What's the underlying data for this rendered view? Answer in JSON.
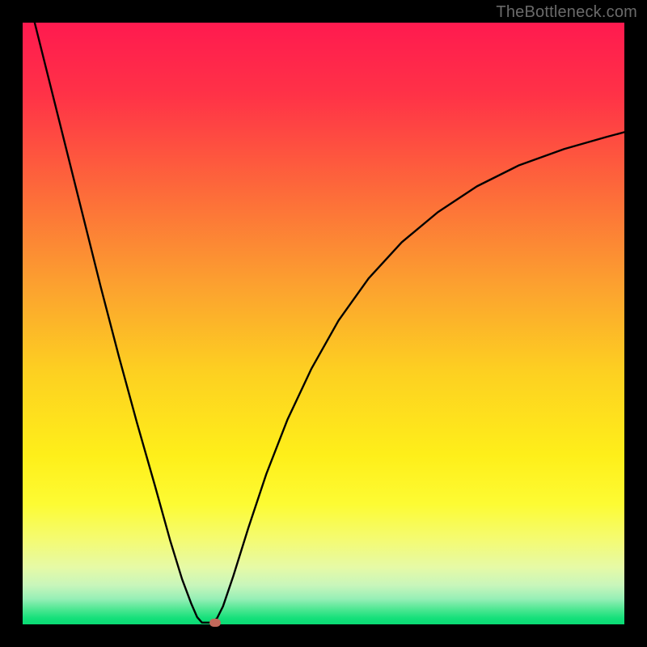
{
  "watermark": "TheBottleneck.com",
  "chart_data": {
    "type": "line",
    "title": "",
    "xlabel": "",
    "ylabel": "",
    "xlim": [
      0,
      100
    ],
    "ylim": [
      0,
      100
    ],
    "background_gradient": {
      "stops": [
        {
          "offset": 0.0,
          "color": "#ff1a4f"
        },
        {
          "offset": 0.12,
          "color": "#ff3247"
        },
        {
          "offset": 0.28,
          "color": "#fd6a3a"
        },
        {
          "offset": 0.44,
          "color": "#fca22f"
        },
        {
          "offset": 0.58,
          "color": "#fdd021"
        },
        {
          "offset": 0.72,
          "color": "#feef1a"
        },
        {
          "offset": 0.8,
          "color": "#fdfb33"
        },
        {
          "offset": 0.86,
          "color": "#f4fb73"
        },
        {
          "offset": 0.905,
          "color": "#e6faa6"
        },
        {
          "offset": 0.935,
          "color": "#c8f6bb"
        },
        {
          "offset": 0.958,
          "color": "#95efb6"
        },
        {
          "offset": 0.975,
          "color": "#4ee792"
        },
        {
          "offset": 0.99,
          "color": "#14e07a"
        },
        {
          "offset": 1.0,
          "color": "#0adb74"
        }
      ]
    },
    "series": [
      {
        "name": "bottleneck-curve",
        "color": "#000000",
        "points": [
          {
            "x": 2.0,
            "y": 100.0
          },
          {
            "x": 4.0,
            "y": 92.0
          },
          {
            "x": 7.0,
            "y": 80.0
          },
          {
            "x": 10.0,
            "y": 68.0
          },
          {
            "x": 13.0,
            "y": 56.0
          },
          {
            "x": 16.0,
            "y": 44.5
          },
          {
            "x": 19.0,
            "y": 33.5
          },
          {
            "x": 22.0,
            "y": 23.0
          },
          {
            "x": 24.5,
            "y": 14.0
          },
          {
            "x": 26.5,
            "y": 7.5
          },
          {
            "x": 28.0,
            "y": 3.5
          },
          {
            "x": 29.0,
            "y": 1.2
          },
          {
            "x": 29.8,
            "y": 0.3
          },
          {
            "x": 31.5,
            "y": 0.3
          },
          {
            "x": 32.3,
            "y": 1.0
          },
          {
            "x": 33.3,
            "y": 3.0
          },
          {
            "x": 35.0,
            "y": 8.0
          },
          {
            "x": 37.5,
            "y": 16.0
          },
          {
            "x": 40.5,
            "y": 25.0
          },
          {
            "x": 44.0,
            "y": 34.0
          },
          {
            "x": 48.0,
            "y": 42.5
          },
          {
            "x": 52.5,
            "y": 50.5
          },
          {
            "x": 57.5,
            "y": 57.5
          },
          {
            "x": 63.0,
            "y": 63.5
          },
          {
            "x": 69.0,
            "y": 68.5
          },
          {
            "x": 75.5,
            "y": 72.8
          },
          {
            "x": 82.5,
            "y": 76.3
          },
          {
            "x": 90.0,
            "y": 79.0
          },
          {
            "x": 97.0,
            "y": 81.0
          },
          {
            "x": 100.0,
            "y": 81.8
          }
        ]
      }
    ],
    "marker": {
      "x": 32.0,
      "y": 0.3,
      "color": "#c1695b"
    }
  }
}
